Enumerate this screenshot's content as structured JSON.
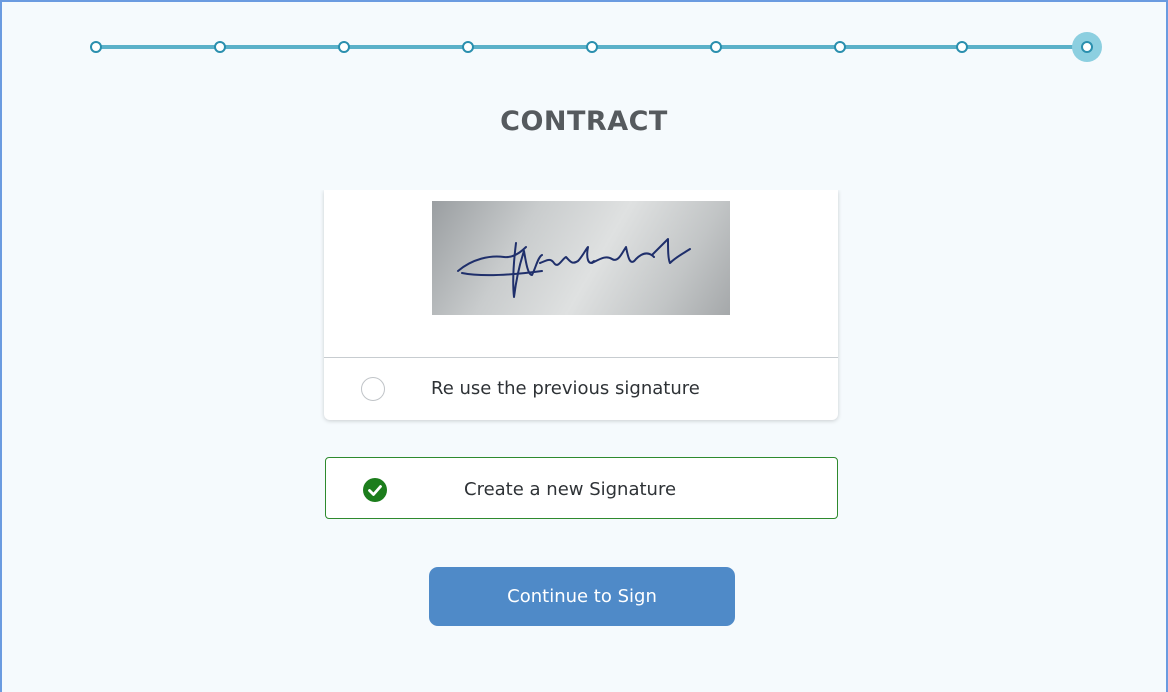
{
  "progress": {
    "total_steps": 9,
    "current_step": 9
  },
  "page": {
    "title": "CONTRACT"
  },
  "signature_card": {
    "image_alt": "previous-signature-image",
    "reuse_label": "Re use the previous signature",
    "reuse_selected": false
  },
  "new_signature": {
    "label": "Create a new Signature",
    "selected": true
  },
  "actions": {
    "continue_label": "Continue to Sign"
  },
  "colors": {
    "accent": "#4f8ac8",
    "stepper": "#5bb1c9",
    "selected_border": "#2e8a2e",
    "check": "#1c7d1c",
    "title": "#555a5e"
  },
  "icons": {
    "radio": "radio-unchecked-icon",
    "check": "check-circle-icon"
  }
}
